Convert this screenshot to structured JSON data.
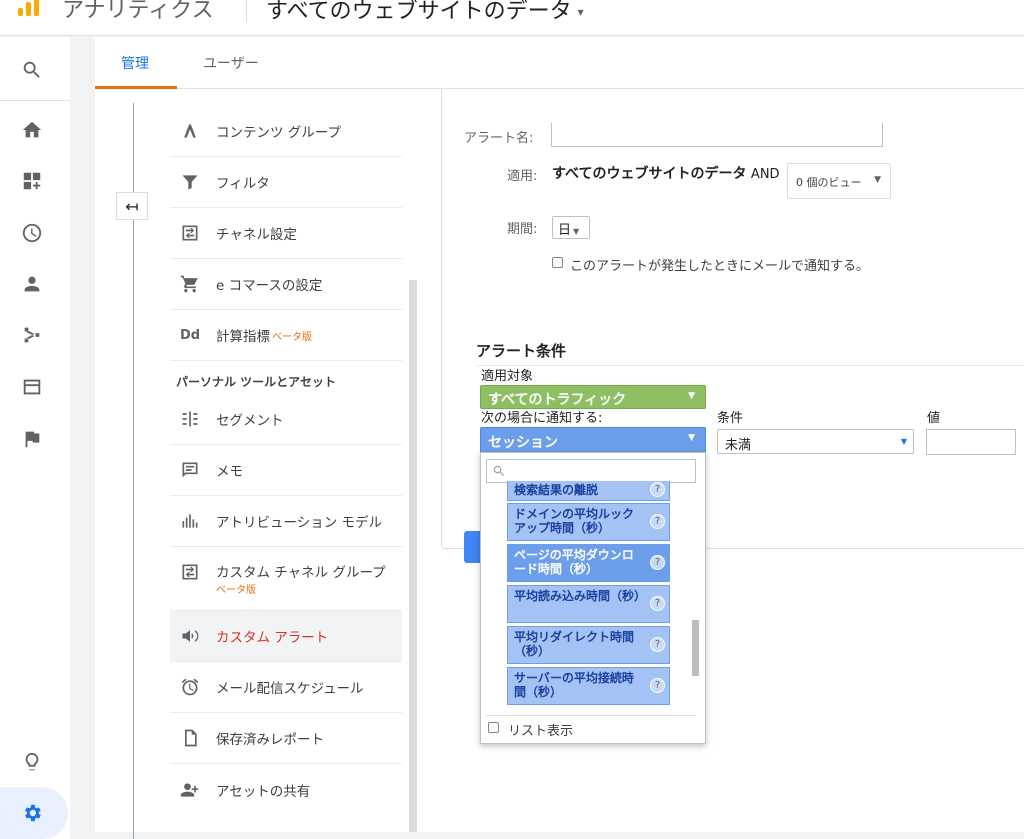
{
  "header": {
    "app_name": "アナリティクス",
    "property": "すべてのウェブサイトのデータ",
    "property_caret": "▾",
    "brand_color": "#f9ab00"
  },
  "rail": {
    "icons": [
      "search-icon",
      "home-icon",
      "customization-icon",
      "realtime-clock-icon",
      "audience-person-icon",
      "acquisition-icon",
      "behavior-icon",
      "conversions-flag-icon",
      "lightbulb-icon",
      "admin-gear-icon"
    ]
  },
  "tabs": {
    "admin": "管理",
    "user": "ユーザー",
    "active_color": "#1a73e8",
    "underline_color": "#e8710a"
  },
  "back_button": "↤",
  "menu": {
    "items": [
      {
        "label": "コンテンツ グループ",
        "icon": "content-grouping-icon"
      },
      {
        "label": "フィルタ",
        "icon": "filter-icon"
      },
      {
        "label": "チャネル設定",
        "icon": "channel-settings-icon"
      },
      {
        "label": "e コマースの設定",
        "icon": "cart-icon"
      },
      {
        "label": "計算指標",
        "beta": "ベータ版",
        "icon": "calculated-metrics-icon",
        "icon_text": "Dd"
      }
    ],
    "section_heading": "パーソナル ツールとアセット",
    "personal_items": [
      {
        "label": "セグメント",
        "icon": "segment-icon"
      },
      {
        "label": "メモ",
        "icon": "annotation-icon"
      },
      {
        "label": "アトリビューション モデル",
        "icon": "attribution-icon"
      },
      {
        "label": "カスタム チャネル グループ",
        "beta": "ベータ版",
        "icon": "custom-channel-icon"
      },
      {
        "label": "カスタム アラート",
        "icon": "megaphone-icon",
        "active": true
      },
      {
        "label": "メール配信スケジュール",
        "icon": "alarm-clock-icon"
      },
      {
        "label": "保存済みレポート",
        "icon": "saved-report-icon"
      },
      {
        "label": "アセットの共有",
        "icon": "share-person-icon"
      }
    ],
    "active_color": "#d93025",
    "beta_color": "#e8710a"
  },
  "form": {
    "alert_name_label": "アラート名:",
    "alert_name_value": "",
    "apply_label": "適用:",
    "apply_property": "すべてのウェブサイトのデータ",
    "apply_and": "AND",
    "views_dropdown": "0 個のビュー",
    "period_label": "期間:",
    "period_value": "日",
    "email_checkbox_label": "このアラートが発生したときにメールで通知する。",
    "email_checked": false
  },
  "conditions": {
    "title": "アラート条件",
    "applies_to_label": "適用対象",
    "applies_to_value": "すべてのトラフィック",
    "notify_label": "次の場合に通知する:",
    "metric_value": "セッション",
    "condition_label": "条件",
    "condition_value": "未満",
    "value_label": "値",
    "value_input": "",
    "green_color": "#8fbf63",
    "blue_color": "#6d9eeb"
  },
  "metric_popup": {
    "search_placeholder": "",
    "options": [
      {
        "label": "検索結果の離脱"
      },
      {
        "label": "ドメインの平均ルックアップ時間（秒）"
      },
      {
        "label": "ページの平均ダウンロード時間（秒）",
        "selected": true
      },
      {
        "label": "平均読み込み時間（秒）"
      },
      {
        "label": "平均リダイレクト時間（秒）"
      },
      {
        "label": "サーバーの平均接続時間（秒）"
      }
    ],
    "help_glyph": "?",
    "list_view_label": "リスト表示",
    "list_view_checked": false
  }
}
